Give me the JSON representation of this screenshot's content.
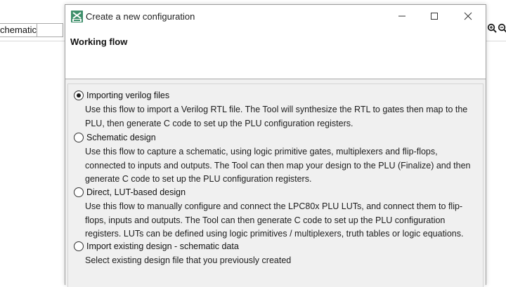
{
  "background_app": {
    "field_text": "chematic"
  },
  "dialog": {
    "title": "Create a new configuration",
    "header_title": "Working flow",
    "options": [
      {
        "label": "Importing verilog files",
        "selected": true,
        "description": "Use this flow to import a Verilog RTL file. The Tool will synthesize the RTL to gates then map to the PLU, then generate C code to set up the PLU configuration registers."
      },
      {
        "label": "Schematic design",
        "selected": false,
        "description": "Use this flow to capture a schematic, using logic primitive gates, multiplexers and flip-flops, connected to inputs and outputs. The Tool can then map your design to the PLU (Finalize) and then generate C code to set up the PLU configuration registers."
      },
      {
        "label": "Direct, LUT-based design",
        "selected": false,
        "description": "Use this flow to manually configure and connect the LPC80x PLU LUTs, and connect them to flip-flops, inputs and outputs. The Tool can then generate C code to set up the PLU configuration registers. LUTs can be defined using logic primitives / multiplexers, truth tables or logic equations."
      },
      {
        "label": "Import existing design - schematic data",
        "selected": false,
        "description": "Select existing design file that you previously created"
      }
    ]
  }
}
